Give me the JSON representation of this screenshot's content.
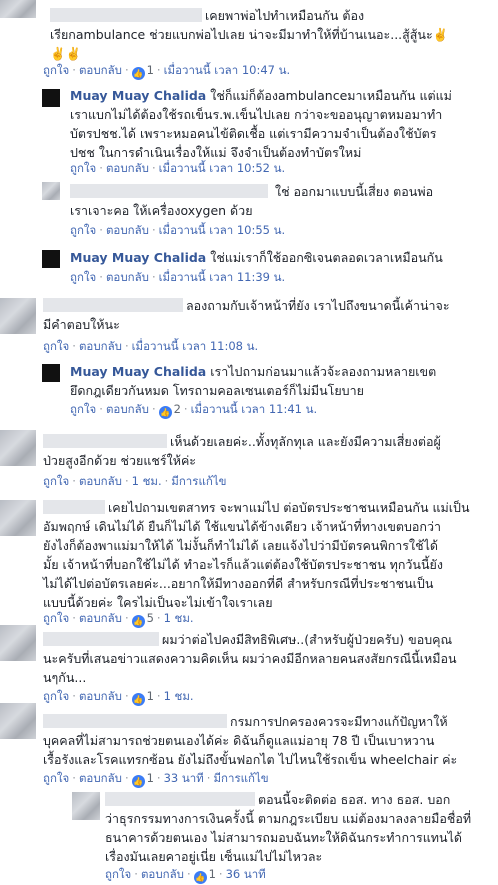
{
  "labels": {
    "like": "ถูกใจ",
    "reply": "ตอบกลับ",
    "edited": "มีการแก้ไข"
  },
  "comments": [
    {
      "lines": [
        "เคยพาพ่อไปทำเหมือนกัน ต้อง",
        "เรียกambulance ช่วยแบกพ่อไปเลย น่าจะมีมาทำให้ที่บ้านเนอะ...สู้สู้นะ✌️",
        "✌️✌️"
      ],
      "likes": "1",
      "time": "เมื่อวานนี้ เวลา 10:47 น."
    },
    {
      "author": "Muay Muay Chalida",
      "lines": [
        "ใช่ก็แม่ก็ต้องambulanceมาเหมือนกัน แต่แม่",
        "เราแบกไม่ได้ต้องใช้รถเข็นร.พ.เข็นไปเลย กว่าจะขออนุญาตหมอมาทำ",
        "บัตรปชช.ได้ เพราะหมอคนไข้ติดเชื้อ แต่เรามีความจำเป็นต้องใช้บัตร",
        "ปชช ในการดำเนินเรื่องให้แม่ จึงจำเป็นต้องทำบัตรใหม่"
      ],
      "time": "เมื่อวานนี้ เวลา 10:52 น."
    },
    {
      "lines": [
        "ใช่ ออกมาแบบนี้เสี่ยง ตอนพ่อ",
        "เราเจาะคอ ให้เครื่องoxygen ด้วย"
      ],
      "time": "เมื่อวานนี้ เวลา 10:55 น."
    },
    {
      "author": "Muay Muay Chalida",
      "lines": [
        "ใช่แม่เราก็ใช้ออกซิเจนตลอดเวลาเหมือนกัน"
      ],
      "time": "เมื่อวานนี้ เวลา 11:39 น."
    },
    {
      "lines": [
        "ลองถามกับเจ้าหน้าที่ยัง เราไปถึงขนาดนี้เค้าน่าจะ",
        "มีคำตอบให้นะ"
      ],
      "time": "เมื่อวานนี้ เวลา 11:08 น."
    },
    {
      "author": "Muay Muay Chalida",
      "lines": [
        "เราไปถามก่อนมาแล้วจ้ะลองถามหลายเขต",
        "ยึดกฎเดียวกันหมด โทรถามคอลเซนเตอร์ก็ไม่มีนโยบาย"
      ],
      "likes": "2",
      "time": "เมื่อวานนี้ เวลา 11:41 น."
    },
    {
      "lines": [
        "เห็นด้วยเลยค่ะ..ทั้งทุลักทุเล และยังมีความเสี่ยงต่อผู้",
        "ป่วยสูงอีกด้วย ช่วยแชร์ให้ค่ะ"
      ],
      "time": "1 ชม."
    },
    {
      "lines": [
        "เคยไปถามเขตสาทร จะพาแม่ไป ต่อบัตรประชาชนเหมือนกัน แม่เป็น",
        "อัมพฤกษ์ เดินไม่ได้ ยืนก็ไม่ได้ ใช้แขนได้ข้างเดียว เจ้าหน้าที่ทางเขตบอกว่า",
        "ยังไงก็ต้องพาแม่มาให้ได้ ไม่งั้นก็ทำไม่ได้ เลยแจ้งไปว่ามีบัตรคนพิการใช้ได้",
        "มั้ย เจ้าหน้าที่บอกใช้ไม่ได้ ทำอะไรก็แล้วแต่ต้องใช้บัตรประชาชน ทุกวันนี้ยัง",
        "ไม่ได้ไปต่อบัตรเลยค่ะ...อยากให้มีทางออกที่ดี สำหรับกรณีที่ประชาชนเป็น",
        "แบบนี้ด้วยค่ะ ใครไม่เป็นจะไม่เข้าใจเราเลย"
      ],
      "likes": "5",
      "time": "1 ชม."
    },
    {
      "lines": [
        "ผมว่าต่อไปคงมีสิทธิพิเศษ..(สำหรับผู้ป่วยครับ) ขอบคุณ",
        "นะครับที่เสนอข่าวแสดงความคิดเห็น ผมว่าคงมีอีกหลายคนสงสัยกรณีนี้เหมือน",
        "นๆกัน..."
      ],
      "likes": "1",
      "time": "1 ชม."
    },
    {
      "lines": [
        "กรมการปกครองควรจะมีทางแก้ปัญหาให้",
        "บุคคลที่ไม่สามารถช่วยตนเองได้ค่ะ ดิฉันก็ดูแลแม่อายุ 78 ปี เป็นเบาหวาน",
        "เรื้อรังและโรคแทรกซ้อน ยังไม่ถึงขั้นฟอกไต ไปไหนใช้รถเข็น wheelchair ค่ะ"
      ],
      "likes": "1",
      "time": "33 นาที"
    },
    {
      "lines": [
        "ตอนนี้จะติดต่อ ธอส. ทาง ธอส. บอก",
        "ว่าธุรกรรมทางการเงินครั้งนี้ ตามกฎระเบียบ แม่ต้องมาลงลายมือชื่อที่",
        "ธนาคารด้วยตนเอง ไม่สามารถมอบฉันทะให้ดิฉันกระทำการแทนได้",
        "เรื่องมันเลยคาอยู่เนี่ย เซ็นแม่ไปไม่ไหวละ"
      ],
      "likes": "1",
      "time": "36 นาที"
    }
  ]
}
